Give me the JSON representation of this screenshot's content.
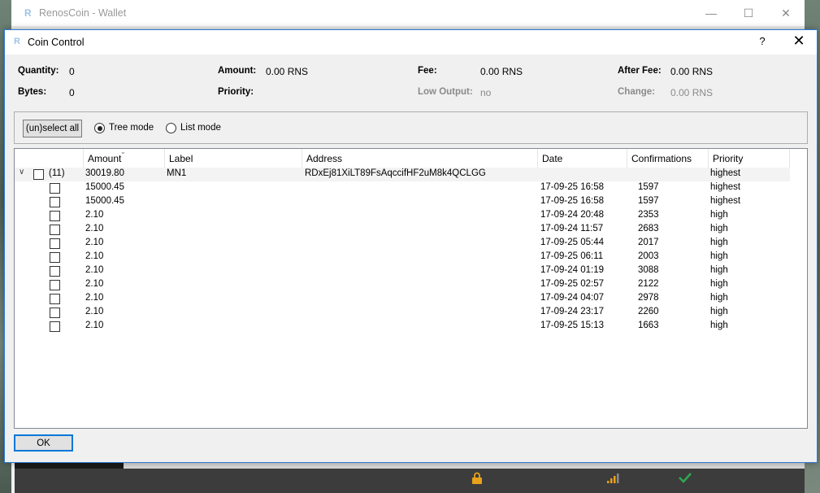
{
  "wallet": {
    "title": "RenosCoin - Wallet",
    "minimize": "—",
    "maximize": "☐",
    "close": "✕"
  },
  "dialog": {
    "title": "Coin Control",
    "help": "?",
    "close": "✕"
  },
  "summary": {
    "quantity_label": "Quantity:",
    "quantity_value": "0",
    "bytes_label": "Bytes:",
    "bytes_value": "0",
    "amount_label": "Amount:",
    "amount_value": "0.00 RNS",
    "priority_label": "Priority:",
    "priority_value": "",
    "fee_label": "Fee:",
    "fee_value": "0.00 RNS",
    "low_output_label": "Low Output:",
    "low_output_value": "no",
    "after_fee_label": "After Fee:",
    "after_fee_value": "0.00 RNS",
    "change_label": "Change:",
    "change_value": "0.00 RNS"
  },
  "mode": {
    "select_all": "(un)select all",
    "tree_mode": "Tree mode",
    "list_mode": "List mode",
    "selected": "tree"
  },
  "columns": [
    "Amount",
    "Label",
    "Address",
    "Date",
    "Confirmations",
    "Priority"
  ],
  "parent_row": {
    "count": "(11)",
    "amount": "30019.80",
    "label": "MN1",
    "address": "RDxEj81XiLT89FsAqccifHF2uM8k4QCLGG",
    "date": "",
    "confirmations": "",
    "priority": "highest"
  },
  "rows": [
    {
      "amount": "15000.45",
      "date": "17-09-25 16:58",
      "confirmations": "1597",
      "priority": "highest"
    },
    {
      "amount": "15000.45",
      "date": "17-09-25 16:58",
      "confirmations": "1597",
      "priority": "highest"
    },
    {
      "amount": "2.10",
      "date": "17-09-24 20:48",
      "confirmations": "2353",
      "priority": "high"
    },
    {
      "amount": "2.10",
      "date": "17-09-24 11:57",
      "confirmations": "2683",
      "priority": "high"
    },
    {
      "amount": "2.10",
      "date": "17-09-25 05:44",
      "confirmations": "2017",
      "priority": "high"
    },
    {
      "amount": "2.10",
      "date": "17-09-25 06:11",
      "confirmations": "2003",
      "priority": "high"
    },
    {
      "amount": "2.10",
      "date": "17-09-24 01:19",
      "confirmations": "3088",
      "priority": "high"
    },
    {
      "amount": "2.10",
      "date": "17-09-25 02:57",
      "confirmations": "2122",
      "priority": "high"
    },
    {
      "amount": "2.10",
      "date": "17-09-24 04:07",
      "confirmations": "2978",
      "priority": "high"
    },
    {
      "amount": "2.10",
      "date": "17-09-24 23:17",
      "confirmations": "2260",
      "priority": "high"
    },
    {
      "amount": "2.10",
      "date": "17-09-25 15:13",
      "confirmations": "1663",
      "priority": "high"
    }
  ],
  "ok_button": "OK",
  "status_icons": {
    "lock": "lock-icon",
    "signal": "signal-bars-icon",
    "synced": "checkmark-icon"
  },
  "colors": {
    "accent": "#2b79d6",
    "check_green": "#2fa84f",
    "lock_orange": "#e8a21a"
  }
}
